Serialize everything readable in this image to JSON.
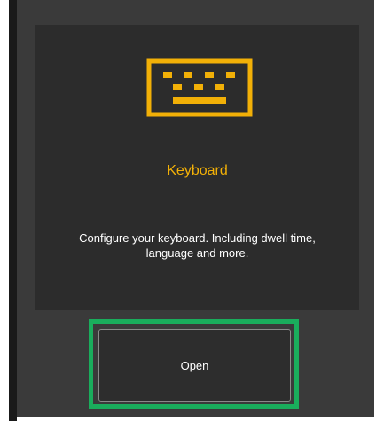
{
  "card": {
    "icon": "keyboard-icon",
    "title": "Keyboard",
    "description": "Configure your keyboard. Including dwell time, language and more."
  },
  "actions": {
    "open_label": "Open"
  },
  "colors": {
    "accent": "#f2b007",
    "highlight": "#1aad5c",
    "panel_bg": "#3a3a3a",
    "card_bg": "#2c2c2c"
  }
}
